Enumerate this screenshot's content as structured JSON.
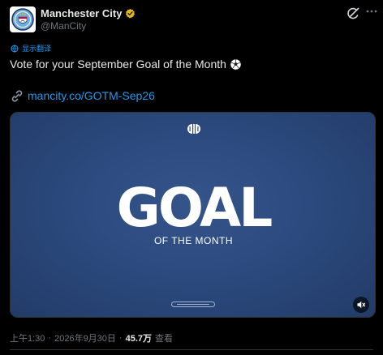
{
  "author": {
    "name": "Manchester City",
    "handle": "@ManCity"
  },
  "translate_label": "显示翻译",
  "tweet": {
    "text": "Vote for your September Goal of the Month",
    "link": "mancity.co/GOTM-Sep26"
  },
  "media": {
    "headline": "GOAL",
    "subline": "OF THE MONTH"
  },
  "meta": {
    "time": "上午1:30",
    "separator": "·",
    "date": "2026年9月30日",
    "views": "45.7万",
    "views_label": "查看"
  },
  "colors": {
    "background": "#000000",
    "accent_link": "#1d9bf0",
    "verified_badge": "#e2b719",
    "media_blue": "#2c4a7e"
  },
  "icons": [
    "mancity-crest-icon",
    "verified-badge-icon",
    "grok-icon",
    "more-icon",
    "translate-icon",
    "soccer-ball-icon",
    "link-icon",
    "gotm-logo-icon",
    "mute-icon"
  ]
}
